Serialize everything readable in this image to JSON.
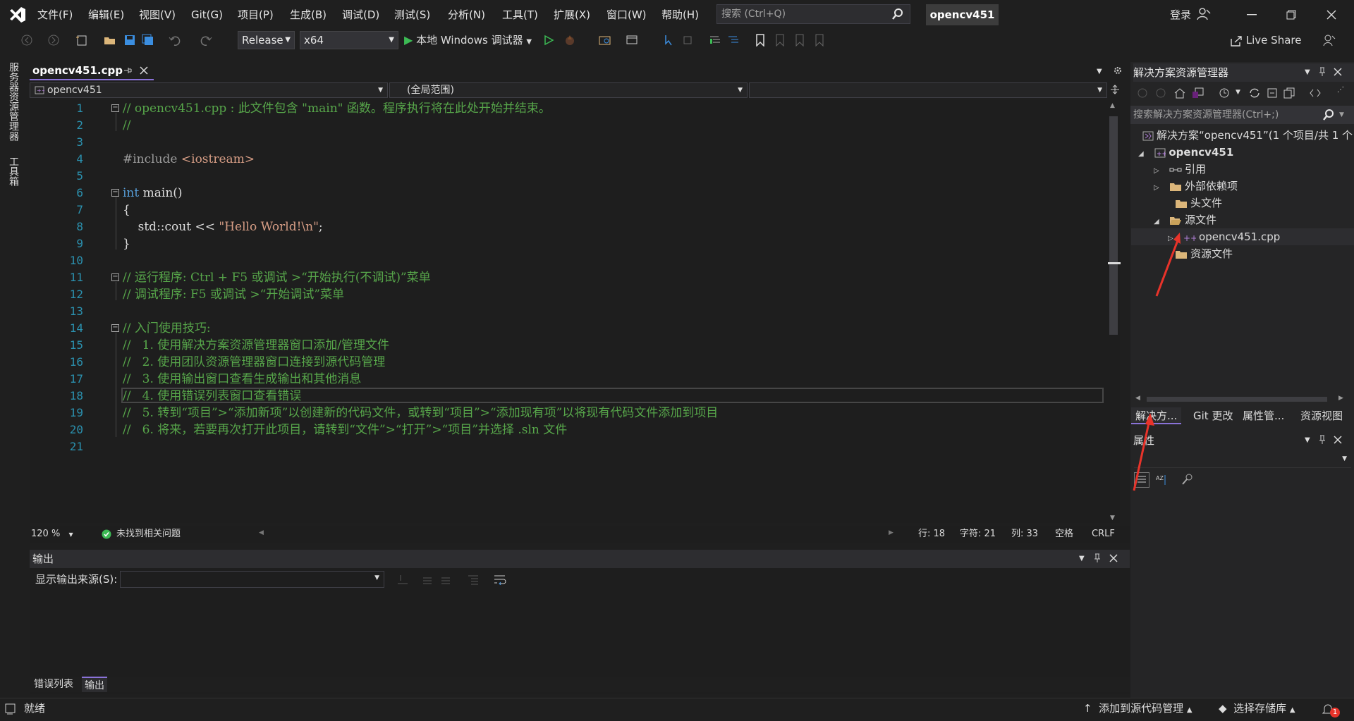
{
  "menu": [
    "文件(F)",
    "编辑(E)",
    "视图(V)",
    "Git(G)",
    "项目(P)",
    "生成(B)",
    "调试(D)",
    "测试(S)",
    "分析(N)",
    "工具(T)",
    "扩展(X)",
    "窗口(W)",
    "帮助(H)"
  ],
  "search": {
    "placeholder": "搜索 (Ctrl+Q)"
  },
  "solution_chip": "opencv451",
  "login": "登录",
  "toolbar": {
    "config": "Release",
    "platform": "x64",
    "debugger": "本地 Windows 调试器",
    "live_share": "Live Share"
  },
  "left_tools": {
    "server_explorer": "服务器资源管理器",
    "toolbox": "工具箱"
  },
  "doc_tab": {
    "name": "opencv451.cpp"
  },
  "nav": {
    "project": "opencv451",
    "scope": "(全局范围)"
  },
  "editor": {
    "line_numbers": [
      "1",
      "2",
      "3",
      "4",
      "5",
      "6",
      "7",
      "8",
      "9",
      "10",
      "11",
      "12",
      "13",
      "14",
      "15",
      "16",
      "17",
      "18",
      "19",
      "20",
      "21"
    ],
    "lines": [
      "// opencv451.cpp : 此文件包含 \"main\" 函数。程序执行将在此处开始并结束。",
      "//",
      "",
      "#include <iostream>",
      "",
      "int main()",
      "{",
      "    std::cout << \"Hello World!\\n\";",
      "}",
      "",
      "// 运行程序: Ctrl + F5 或调试 >“开始执行(不调试)”菜单",
      "// 调试程序: F5 或调试 >“开始调试”菜单",
      "",
      "// 入门使用技巧:",
      "//   1. 使用解决方案资源管理器窗口添加/管理文件",
      "//   2. 使用团队资源管理器窗口连接到源代码管理",
      "//   3. 使用输出窗口查看生成输出和其他消息",
      "//   4. 使用错误列表窗口查看错误",
      "//   5. 转到“项目”>“添加新项”以创建新的代码文件，或转到“项目”>“添加现有项”以将现有代码文件添加到项目",
      "//   6. 将来，若要再次打开此项目，请转到“文件”>“打开”>“项目”并选择 .sln 文件",
      ""
    ],
    "include_kw": "#include",
    "include_target": "<iostream>",
    "main_kw": "int",
    "main_rest": " main()",
    "cout_pre": "std::cout << ",
    "cout_str": "\"Hello World!\\n\"",
    "cout_post": ";"
  },
  "editor_status": {
    "zoom": "120 %",
    "issues": "未找到相关问题",
    "line": "行: 18",
    "char": "字符: 21",
    "col": "列: 33",
    "spaces": "空格",
    "eol": "CRLF"
  },
  "output": {
    "title": "输出",
    "source_label": "显示输出来源(S):"
  },
  "bottom_tabs": [
    "错误列表",
    "输出"
  ],
  "status_bar": {
    "ready": "就绪",
    "add_source": "添加到源代码管理",
    "select_repo": "选择存储库",
    "notif_count": "1"
  },
  "solution_explorer": {
    "title": "解决方案资源管理器",
    "search_placeholder": "搜索解决方案资源管理器(Ctrl+;)",
    "solution": "解决方案“opencv451”(1 个项目/共 1 个",
    "project": "opencv451",
    "items": [
      "引用",
      "外部依赖项",
      "头文件",
      "源文件",
      "opencv451.cpp",
      "资源文件"
    ]
  },
  "right_tabs": [
    "解决方...",
    "Git 更改",
    "属性管...",
    "资源视图"
  ],
  "properties": {
    "title": "属性"
  },
  "colors": {
    "accent": "#8a72d8",
    "comment": "#57a64a",
    "keyword": "#569cd6",
    "string": "#d69d85",
    "line_number": "#2b91af",
    "annotation_arrow": "#e8332a"
  }
}
